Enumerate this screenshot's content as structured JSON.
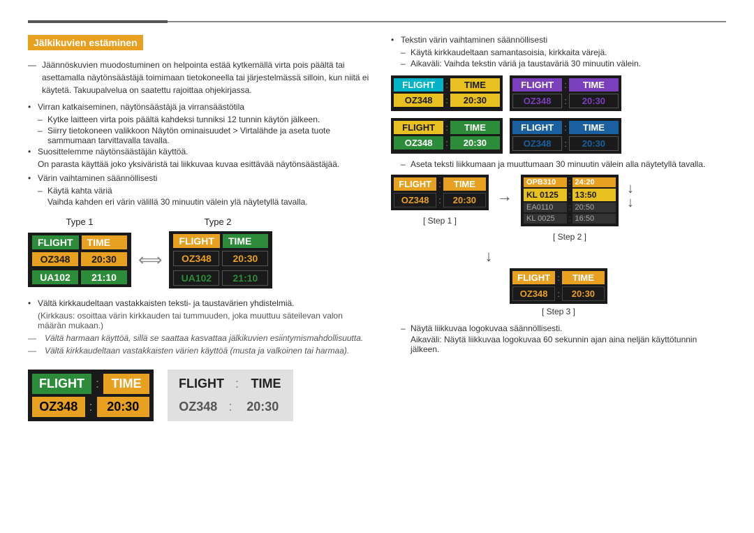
{
  "page": {
    "title": "Jälkikuvien estäminen"
  },
  "left": {
    "intro": "Jäännöskuvien muodostuminen on helpointa estää kytkemällä virta pois päältä tai asettamalla näytönsäästäjä toimimaan tietokoneella tai järjestelmässä silloin, kun niitä ei käytetä. Takuupalvelua on saatettu rajoittaa ohjekirjassa.",
    "bullet1": "Virran katkaiseminen, näytönsäästäjä ja virransäästötila",
    "dash1a": "Kytke laitteen virta pois päältä kahdeksi tunniksi 12 tunnin käytön jälkeen.",
    "dash1b": "Siirry tietokoneen valikkoon Näytön ominaisuudet > Virtalähde ja aseta tuote sammumaan tarvittavalla tavalla.",
    "bullet2": "Suosittelemme näytönsäästäjän käyttöä.",
    "sub2": "On parasta käyttää joko yksiväristä tai liikkuvaa kuvaa esittävää näytönsäästäjää.",
    "bullet3": "Värin vaihtaminen säännöllisesti",
    "dash3a": "Käytä kahta väriä",
    "sub3a": "Vaihda kahden eri värin välillä 30 minuutin välein ylä näytetyllä tavalla.",
    "type1_label": "Type 1",
    "type2_label": "Type 2",
    "board_header_col1": "FLIGHT",
    "board_header_col2": "TIME",
    "board_data1_col1": "OZ348",
    "board_data1_col2": "20:30",
    "board_data2_col1": "UA102",
    "board_data2_col2": "21:10",
    "warn1": "Vältä kirkkaudeltaan vastakkaisten teksti- ja taustavärien yhdistelmiä.",
    "warn1_sub": "(Kirkkaus: osoittaa värin kirkkauden tai tummuuden, joka muuttuu säteilevan valon määrän mukaan.)",
    "warn2": "Vältä harmaan käyttöä, sillä se saattaa kasvattaa jälkikuvien esiintymismahdollisuutta.",
    "warn3": "Vältä kirkkaudeltaan vastakkaisten värien käyttöä (musta ja valkoinen tai harmaa).",
    "big_board1_h1": "FLIGHT",
    "big_board1_h2": "TIME",
    "big_board1_d1": "OZ348",
    "big_board1_d2": "20:30",
    "big_board2_h1": "FLIGHT",
    "big_board2_h2": "TIME",
    "big_board2_d1": "OZ348",
    "big_board2_d2": "20:30"
  },
  "right": {
    "dot1": "Tekstin värin vaihtaminen säännöllisesti",
    "dash1": "Käytä kirkkaudeltaan samantasoisia, kirkkaita värejä.",
    "dash2": "Aikaväli: Vaihda tekstin väriä ja taustaväriä 30 minuutin välein.",
    "board_header1": "FLIGHT",
    "board_header2": "TIME",
    "board_colon": ":",
    "board_data1": "OZ348",
    "board_data2": "20:30",
    "board_variants": [
      {
        "bg": "cyan-green",
        "h1": "FLIGHT",
        "h2": "TIME",
        "d1": "OZ348",
        "d2": "20:30"
      },
      {
        "bg": "purple",
        "h1": "FLIGHT",
        "h2": "TIME",
        "d1": "OZ348",
        "d2": "20:30"
      },
      {
        "bg": "green-yellow",
        "h1": "FLIGHT",
        "h2": "TIME",
        "d1": "OZ348",
        "d2": "20:30"
      },
      {
        "bg": "blue",
        "h1": "FLIGHT",
        "h2": "TIME",
        "d1": "OZ348",
        "d2": "20:30"
      }
    ],
    "dash_note": "Aseta teksti liikkumaan ja muuttumaan 30 minuutin välein alla näytetyllä tavalla.",
    "step1_label": "[ Step 1 ]",
    "step2_label": "[ Step 2 ]",
    "step3_label": "[ Step 3 ]",
    "scroll_rows": [
      {
        "c1": "OPB310",
        "c2": "24:20"
      },
      {
        "c1": "KL 0125",
        "c2": "13:50"
      },
      {
        "c1": "EA0110",
        "c2": "20:50"
      },
      {
        "c1": "KL 0025",
        "c2": "16:50"
      }
    ],
    "note2_dash": "Näytä liikkuvaa logokuvaa säännöllisesti.",
    "note2_sub": "Aikaväli: Näytä liikkuvaa logokuvaa 60 sekunnin ajan aina neljän käyttötunnin jälkeen."
  }
}
